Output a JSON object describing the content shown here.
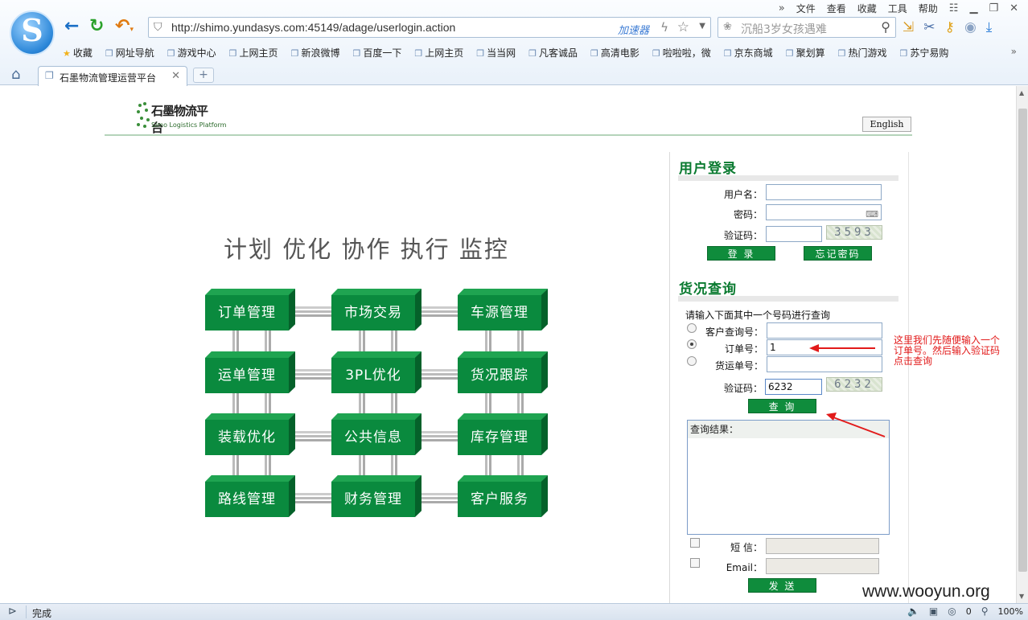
{
  "browser": {
    "menu": [
      "文件",
      "查看",
      "收藏",
      "工具",
      "帮助"
    ],
    "url": "http://shimo.yundasys.com:45149/adage/userlogin.action",
    "accelerator_label": "加速器",
    "search_placeholder": "沉船3岁女孩遇难",
    "bookmarks": [
      "收藏",
      "网址导航",
      "游戏中心",
      "上网主页",
      "新浪微博",
      "百度一下",
      "上网主页",
      "当当网",
      "凡客诚品",
      "高清电影",
      "啦啦啦，微",
      "京东商城",
      "聚划算",
      "热门游戏",
      "苏宁易购"
    ],
    "tab_title": "石墨物流管理运营平台",
    "status_text": "完成",
    "status_count": "0",
    "zoom": "100%"
  },
  "site": {
    "logo_name": "石墨物流平台",
    "logo_en": "Simo Logistics Platform",
    "english_button": "English",
    "slogan": "计划 优化 协作 执行 监控",
    "modules": [
      "订单管理",
      "市场交易",
      "车源管理",
      "运单管理",
      "3PL优化",
      "货况跟踪",
      "装载优化",
      "公共信息",
      "库存管理",
      "路线管理",
      "财务管理",
      "客户服务"
    ]
  },
  "login": {
    "title": "用户登录",
    "username_label": "用户名：",
    "username_value": "",
    "password_label": "密码：",
    "captcha_label": "验证码：",
    "captcha_value": "",
    "captcha_image_text": "3593",
    "login_button": "登 录",
    "forgot_button": "忘记密码"
  },
  "tracking": {
    "title": "货况查询",
    "instruction": "请输入下面其中一个号码进行查询",
    "customer_no_label": "客户查询号：",
    "customer_no_value": "",
    "order_no_label": "订单号：",
    "order_no_value": "1",
    "waybill_no_label": "货运单号：",
    "waybill_no_value": "",
    "selected_option": "订单号",
    "captcha_label": "验证码：",
    "captcha_value": "6232",
    "captcha_image_text": "6232",
    "query_button": "查 询",
    "result_label": "查询结果：",
    "sms_label": "短 信：",
    "email_label": "Email：",
    "send_button": "发 送"
  },
  "annotation": {
    "text": "这里我们先随便输入一个订单号。然后输入验证码点击查询",
    "color": "#e21a1a"
  },
  "watermark": "www.wooyun.org",
  "colors": {
    "brand_green": "#0a8a3e",
    "title_green": "#0a7a30",
    "annotation_red": "#e21a1a"
  }
}
